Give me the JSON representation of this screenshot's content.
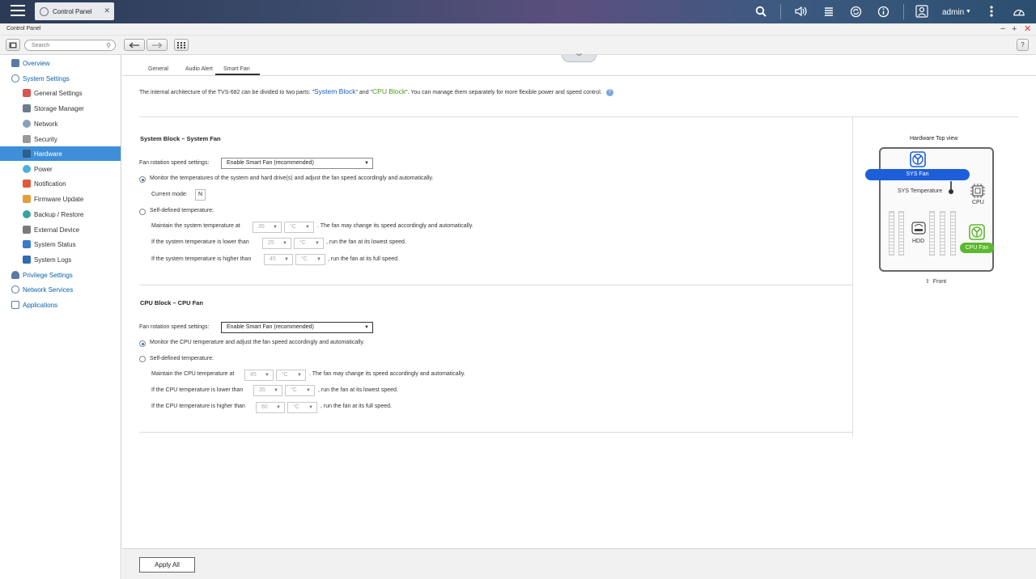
{
  "topbar": {
    "app_tab_label": "Control Panel",
    "user_label": "admin"
  },
  "window": {
    "title": "Control Panel"
  },
  "toolbar": {
    "search_placeholder": "Search"
  },
  "sidebar": {
    "items": [
      {
        "label": "Overview"
      },
      {
        "label": "System Settings"
      },
      {
        "label": "General Settings"
      },
      {
        "label": "Storage Manager"
      },
      {
        "label": "Network"
      },
      {
        "label": "Security"
      },
      {
        "label": "Hardware"
      },
      {
        "label": "Power"
      },
      {
        "label": "Notification"
      },
      {
        "label": "Firmware Update"
      },
      {
        "label": "Backup / Restore"
      },
      {
        "label": "External Device"
      },
      {
        "label": "System Status"
      },
      {
        "label": "System Logs"
      },
      {
        "label": "Privilege Settings"
      },
      {
        "label": "Network Services"
      },
      {
        "label": "Applications"
      }
    ]
  },
  "tabs": [
    {
      "label": "General"
    },
    {
      "label": "Audio Alert"
    },
    {
      "label": "Smart Fan"
    }
  ],
  "description": {
    "part1": "The internal architecture of the TVS-682 can be divided to two parts: \"",
    "system_block": "System Block",
    "part2": "\" and \"",
    "cpu_block": "CPU Block",
    "part3": "\". You can manage them separately for more flexible power and speed control."
  },
  "system_block": {
    "title": "System Block – System Fan",
    "fan_speed_label": "Fan rotation speed settings:",
    "fan_speed_value": "Enable Smart Fan (recommended)",
    "monitor_label": "Monitor the temperatures of the system and hard drive(s) and adjust the fan speed accordingly and automatically.",
    "current_mode_label": "Current mode:",
    "current_mode_value": "N",
    "self_defined_label": "Self-defined temperature:",
    "maintain_label": "Maintain the system temperature at",
    "maintain_value": "35",
    "maintain_unit": "°C",
    "maintain_suffix": ". The fan may change its speed accordingly and automatically.",
    "lower_label": "If the system temperature is lower than",
    "lower_value": "25",
    "lower_unit": "°C",
    "lower_suffix": ", run the fan at its lowest speed.",
    "higher_label": "If the system temperature is higher than",
    "higher_value": "45",
    "higher_unit": "°C",
    "higher_suffix": ", run the fan at its full speed."
  },
  "cpu_block": {
    "title": "CPU Block – CPU Fan",
    "fan_speed_label": "Fan rotation speed settings:",
    "fan_speed_value": "Enable Smart Fan (recommended)",
    "monitor_label": "Monitor the CPU temperature and adjust the fan speed accordingly and automatically.",
    "self_defined_label": "Self-defined temperature:",
    "maintain_label": "Maintain the CPU temperature at",
    "maintain_value": "45",
    "maintain_unit": "°C",
    "maintain_suffix": ". The fan may change its speed accordingly and automatically.",
    "lower_label": "If the CPU temperature is lower than",
    "lower_value": "35",
    "lower_unit": "°C",
    "lower_suffix": ", run the fan at its lowest speed.",
    "higher_label": "If the CPU temperature is higher than",
    "higher_value": "60",
    "higher_unit": "°C",
    "higher_suffix": ", run the fan at its full speed."
  },
  "hardware_view": {
    "title": "Hardware Top view",
    "sys_fan": "SYS Fan",
    "sys_temperature": "SYS Temperature",
    "cpu": "CPU",
    "hdd": "HDD",
    "cpu_fan": "CPU Fan",
    "front": "Front"
  },
  "footer": {
    "apply_all": "Apply All"
  },
  "colors": {
    "accent": "#3f8fd8",
    "sys_fan_pill": "#1d5fd8",
    "cpu_fan_pill": "#5cb82e"
  }
}
